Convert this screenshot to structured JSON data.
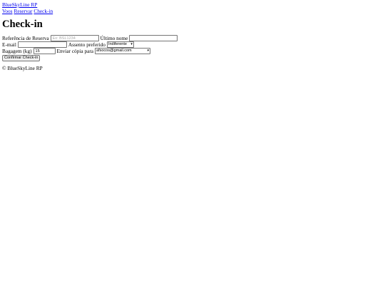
{
  "header": {
    "brand": "BlueSkyLine RP",
    "nav": [
      {
        "label": "Voos"
      },
      {
        "label": "Reservar"
      },
      {
        "label": "Check-in"
      }
    ]
  },
  "main": {
    "title": "Check-in",
    "form": {
      "booking_ref": {
        "label": "Referência de Reserva",
        "value": "",
        "placeholder": "Ex: BSL1234"
      },
      "last_name": {
        "label": "Último nome",
        "value": ""
      },
      "email": {
        "label": "E-mail",
        "value": ""
      },
      "seat_pref": {
        "label": "Assento preferido",
        "selected": "Indiferente"
      },
      "baggage": {
        "label": "Bagagem (kg)",
        "value": "15"
      },
      "send_copy": {
        "label": "Enviar cópia para",
        "selected": "afsocos@gmail.com"
      },
      "submit_label": "Confirmar Check-in"
    }
  },
  "footer": {
    "text": "© BlueSkyLine RP"
  },
  "icons": {
    "select_chevron": "chevron-down-icon"
  },
  "colors": {
    "link": "#0000ee",
    "border": "#767676",
    "button_bg": "#efefef"
  }
}
